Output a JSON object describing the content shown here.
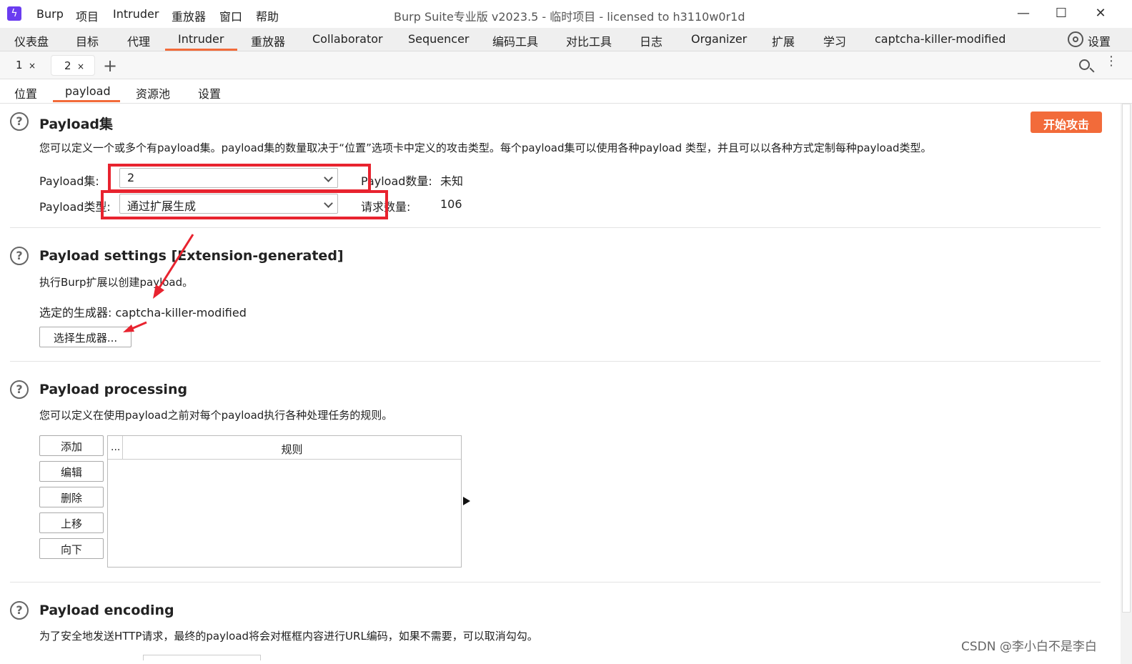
{
  "app": {
    "logo_glyph": "ϟ",
    "menu": [
      "Burp",
      "项目",
      "Intruder",
      "重放器",
      "窗口",
      "帮助"
    ],
    "window_title": "Burp Suite专业版  v2023.5 - 临时项目 - licensed to h3110w0r1d",
    "window_controls": [
      "—",
      "☐",
      "✕"
    ]
  },
  "main_tabs": [
    "仪表盘",
    "目标",
    "代理",
    "Intruder",
    "重放器",
    "Collaborator",
    "Sequencer",
    "编码工具",
    "对比工具",
    "日志",
    "Organizer",
    "扩展",
    "学习",
    "captcha-killer-modified"
  ],
  "settings_label": "设置",
  "attack_tabs": [
    {
      "label": "1",
      "close": "×"
    },
    {
      "label": "2",
      "close": "×"
    }
  ],
  "add_tab": "+",
  "kebab": "⋮",
  "intruder_tabs": [
    "位置",
    "payload",
    "资源池",
    "设置"
  ],
  "help_glyph": "?",
  "payload_sets": {
    "title": "Payload集",
    "start_attack": "开始攻击",
    "description": "您可以定义一个或多个有payload集。payload集的数量取决于“位置”选项卡中定义的攻击类型。每个payload集可以使用各种payload 类型，并且可以以各种方式定制每种payload类型。",
    "set_label": "Payload集:",
    "set_value": "2",
    "count_label": "Payload数量:",
    "count_value": "未知",
    "type_label": "Payload类型:",
    "type_value": "通过扩展生成",
    "requests_label": "请求数量:",
    "requests_value": "106"
  },
  "payload_settings": {
    "title": "Payload settings [Extension-generated]",
    "description": "执行Burp扩展以创建payload。",
    "generator_label": "选定的生成器: captcha-killer-modified",
    "select_button": "选择生成器..."
  },
  "payload_processing": {
    "title": "Payload processing",
    "description": "您可以定义在使用payload之前对每个payload执行各种处理任务的规则。",
    "buttons": [
      "添加",
      "编辑",
      "删除",
      "上移",
      "向下"
    ],
    "table_col1": "...",
    "table_col2": "规则"
  },
  "payload_encoding": {
    "title": "Payload encoding",
    "description": "为了安全地发送HTTP请求，最终的payload将会对框框内容进行URL编码，如果不需要，可以取消勾勾。"
  },
  "watermark": "CSDN @李小白不是李白",
  "colors": {
    "accent": "#f26b3a",
    "annotation_red": "#e8232f",
    "logo": "#6a3cf0"
  }
}
